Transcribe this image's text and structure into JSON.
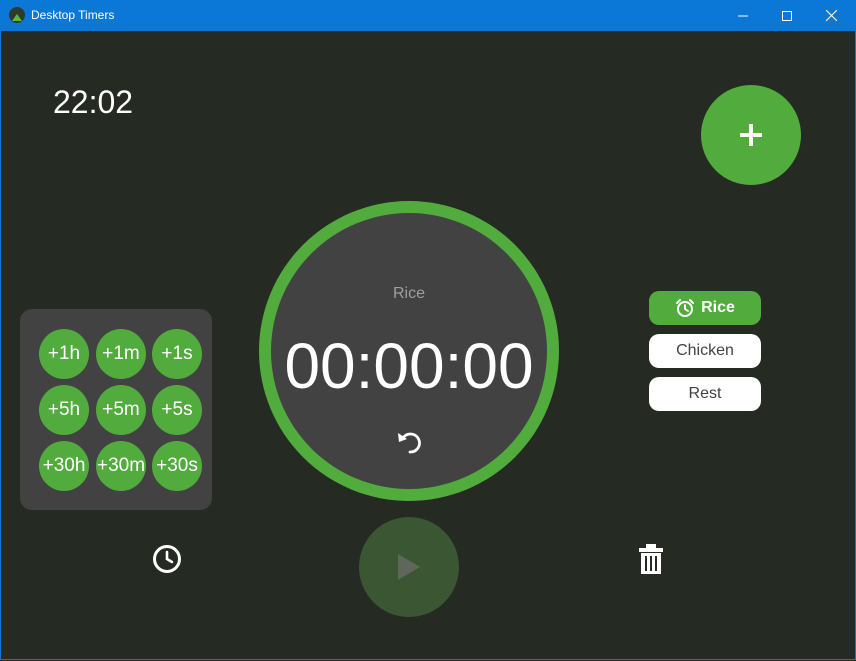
{
  "window": {
    "title": "Desktop Timers"
  },
  "clock": "22:02",
  "timer": {
    "name": "Rice",
    "time": "00:00:00"
  },
  "increments": [
    "+1h",
    "+1m",
    "+1s",
    "+5h",
    "+5m",
    "+5s",
    "+30h",
    "+30m",
    "+30s"
  ],
  "timers": [
    {
      "label": "Rice",
      "active": true
    },
    {
      "label": "Chicken",
      "active": false
    },
    {
      "label": "Rest",
      "active": false
    }
  ],
  "colors": {
    "accent": "#52ac3d",
    "background": "#252b22",
    "panel": "#424242",
    "titlebar": "#0b78d7"
  },
  "icons": [
    "app-icon",
    "minimize-icon",
    "maximize-icon",
    "close-icon",
    "plus-icon",
    "reset-icon",
    "alarm-clock-icon",
    "history-clock-icon",
    "play-icon",
    "trash-icon"
  ]
}
